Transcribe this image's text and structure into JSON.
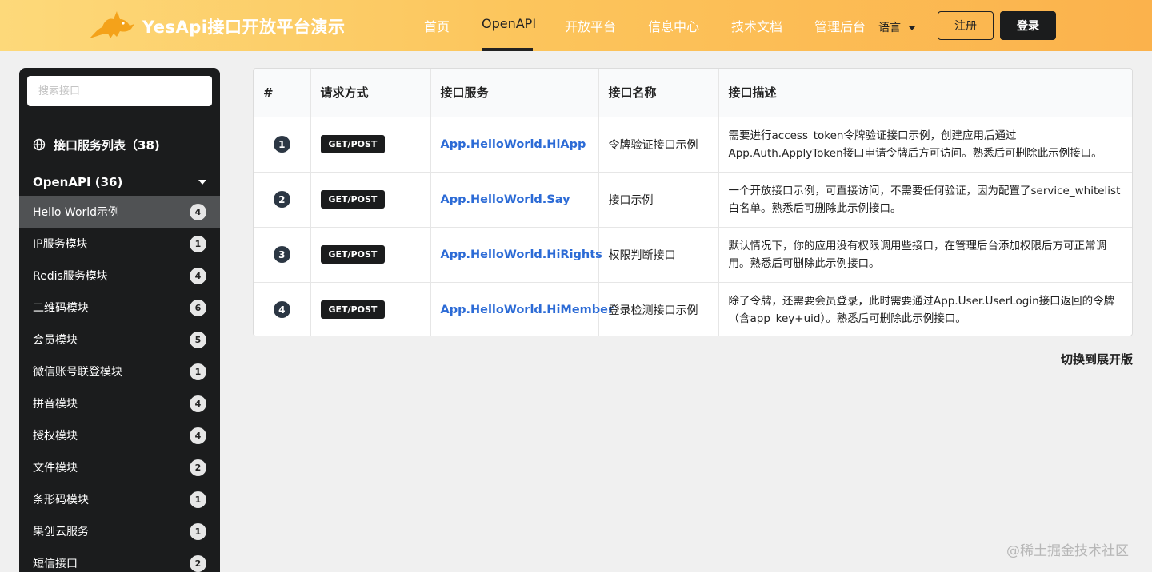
{
  "header": {
    "brand": "YesApi接口开放平台演示",
    "nav": [
      "首页",
      "OpenAPI",
      "开放平台",
      "信息中心",
      "技术文档",
      "管理后台"
    ],
    "active_nav": "OpenAPI",
    "language_label": "语言",
    "register_label": "注册",
    "login_label": "登录",
    "logo_icon": "fox-logo-icon"
  },
  "sidebar": {
    "search_placeholder": "搜索接口",
    "services_title": "接口服务列表（38)",
    "group_title": "OpenAPI (36)",
    "items": [
      {
        "label": "Hello World示例",
        "count": "4",
        "active": true
      },
      {
        "label": "IP服务模块",
        "count": "1"
      },
      {
        "label": "Redis服务模块",
        "count": "4"
      },
      {
        "label": "二维码模块",
        "count": "6"
      },
      {
        "label": "会员模块",
        "count": "5"
      },
      {
        "label": "微信账号联登模块",
        "count": "1"
      },
      {
        "label": "拼音模块",
        "count": "4"
      },
      {
        "label": "授权模块",
        "count": "4"
      },
      {
        "label": "文件模块",
        "count": "2"
      },
      {
        "label": "条形码模块",
        "count": "1"
      },
      {
        "label": "果创云服务",
        "count": "1"
      },
      {
        "label": "短信接口",
        "count": "2"
      }
    ]
  },
  "table": {
    "headers": [
      "#",
      "请求方式",
      "接口服务",
      "接口名称",
      "接口描述"
    ],
    "rows": [
      {
        "num": "1",
        "method": "GET/POST",
        "service": "App.HelloWorld.HiApp",
        "name": "令牌验证接口示例",
        "desc": "需要进行access_token令牌验证接口示例，创建应用后通过App.Auth.ApplyToken接口申请令牌后方可访问。熟悉后可删除此示例接口。"
      },
      {
        "num": "2",
        "method": "GET/POST",
        "service": "App.HelloWorld.Say",
        "name": "接口示例",
        "desc": "一个开放接口示例，可直接访问，不需要任何验证，因为配置了service_whitelist白名单。熟悉后可删除此示例接口。"
      },
      {
        "num": "3",
        "method": "GET/POST",
        "service": "App.HelloWorld.HiRights",
        "name": "权限判断接口",
        "desc": "默认情况下，你的应用没有权限调用些接口，在管理后台添加权限后方可正常调用。熟悉后可删除此示例接口。"
      },
      {
        "num": "4",
        "method": "GET/POST",
        "service": "App.HelloWorld.HiMember",
        "name": "登录检测接口示例",
        "desc": "除了令牌，还需要会员登录，此时需要通过App.User.UserLogin接口返回的令牌（含app_key+uid）。熟悉后可删除此示例接口。"
      }
    ]
  },
  "switch_label": "切换到展开版",
  "watermark": "@稀土掘金技术社区"
}
